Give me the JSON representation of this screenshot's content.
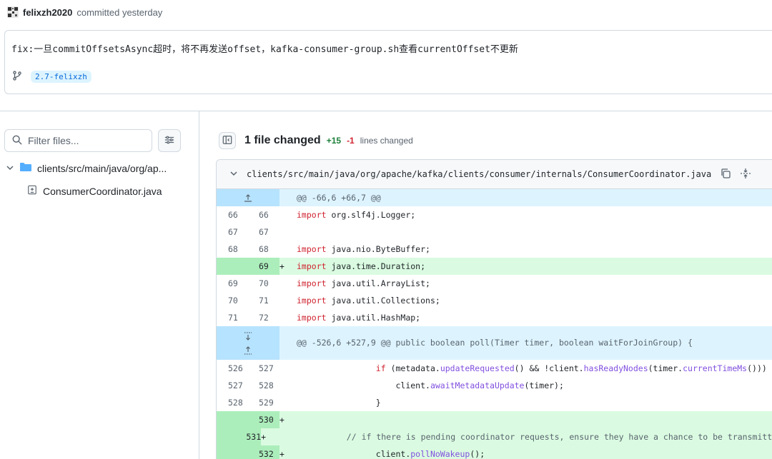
{
  "commit": {
    "author": "felixzh2020",
    "action": "committed yesterday",
    "message": "fix:一旦commitOffsetsAsync超时，将不再发送offset，kafka-consumer-group.sh查看currentOffset不更新",
    "branch": "2.7-felixzh"
  },
  "sidebar": {
    "filter_placeholder": "Filter files...",
    "directory": "clients/src/main/java/org/ap...",
    "file": "ConsumerCoordinator.java"
  },
  "summary": {
    "files_changed": "1 file changed",
    "additions": "+15",
    "deletions": "-1",
    "lines_label": "lines changed"
  },
  "diff": {
    "file_path": "clients/src/main/java/org/apache/kafka/clients/consumer/internals/ConsumerCoordinator.java",
    "hunk1": "@@ -66,6 +66,7 @@",
    "hunk2": "@@ -526,6 +527,9 @@ public boolean poll(Timer timer, boolean waitForJoinGroup) {",
    "lines": [
      {
        "old": "66",
        "new": "66",
        "sign": "",
        "text": "import org.slf4j.Logger;"
      },
      {
        "old": "67",
        "new": "67",
        "sign": "",
        "text": ""
      },
      {
        "old": "68",
        "new": "68",
        "sign": "",
        "text": "import java.nio.ByteBuffer;"
      },
      {
        "old": "",
        "new": "69",
        "sign": "+",
        "text": "import java.time.Duration;"
      },
      {
        "old": "69",
        "new": "70",
        "sign": "",
        "text": "import java.util.ArrayList;"
      },
      {
        "old": "70",
        "new": "71",
        "sign": "",
        "text": "import java.util.Collections;"
      },
      {
        "old": "71",
        "new": "72",
        "sign": "",
        "text": "import java.util.HashMap;"
      },
      {
        "old": "526",
        "new": "527",
        "sign": "",
        "text": "if (metadata.updateRequested() && !client.hasReadyNodes(timer.currentTimeMs())) {"
      },
      {
        "old": "527",
        "new": "528",
        "sign": "",
        "text": "client.awaitMetadataUpdate(timer);"
      },
      {
        "old": "528",
        "new": "529",
        "sign": "",
        "text": "}"
      },
      {
        "old": "",
        "new": "530",
        "sign": "+",
        "text": ""
      },
      {
        "old": "",
        "new": "531",
        "sign": "+",
        "text": "// if there is pending coordinator requests, ensure they have a chance to be transmitted."
      },
      {
        "old": "",
        "new": "532",
        "sign": "+",
        "text": "client.pollNoWakeup();"
      }
    ]
  }
}
